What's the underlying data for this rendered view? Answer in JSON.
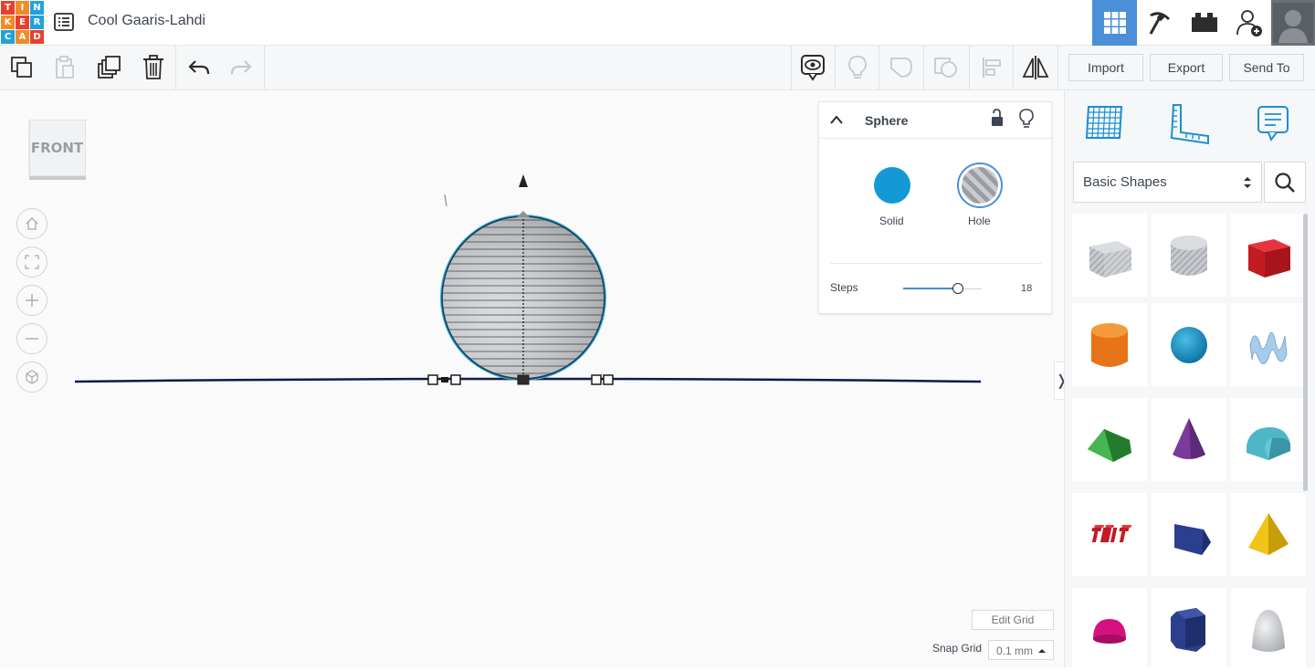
{
  "app": {
    "logo_letters": [
      "T",
      "I",
      "N",
      "K",
      "E",
      "R",
      "C",
      "A",
      "D"
    ],
    "logo_colors": [
      "#e8402e",
      "#f18a27",
      "#22a2dc",
      "#f18a27",
      "#e8402e",
      "#22a2dc",
      "#22a2dc",
      "#f18a27",
      "#e8402e"
    ],
    "title": "Cool Gaaris-Lahdi"
  },
  "topbar": {
    "buttons": [
      "3d-design-icon",
      "codeblocks-pickaxe-icon",
      "bricks-icon",
      "add-user-icon"
    ],
    "active": "3d-design-icon"
  },
  "toolbar": {
    "tools": [
      "copy-icon",
      "paste-icon",
      "duplicate-icon",
      "delete-icon",
      "undo-icon",
      "redo-icon"
    ],
    "right_tools": [
      "notes-visibility-icon",
      "light-bulb-icon",
      "group-icon",
      "ungroup-icon",
      "align-icon",
      "mirror-icon"
    ],
    "import_label": "Import",
    "export_label": "Export",
    "send_to_label": "Send To"
  },
  "viewcube": {
    "face_label": "FRONT"
  },
  "nav_controls": [
    "home-view-icon",
    "fit-view-icon",
    "zoom-in-icon",
    "zoom-out-icon",
    "ortho-view-icon"
  ],
  "inspector": {
    "title": "Sphere",
    "solid_label": "Solid",
    "hole_label": "Hole",
    "solid_color": "#1499d6",
    "selected": "Hole",
    "steps_label": "Steps",
    "steps_value": "18",
    "steps_slider_level": 0.7
  },
  "right_panel": {
    "view_icons": [
      "workplane-icon",
      "ruler-icon",
      "notes-icon"
    ],
    "category": "Basic Shapes",
    "shapes": [
      {
        "name": "box-hole",
        "color": "#b8bcc2"
      },
      {
        "name": "cylinder-hole",
        "color": "#b8bcc2"
      },
      {
        "name": "box",
        "color": "#d4202a"
      },
      {
        "name": "cylinder",
        "color": "#e8741a"
      },
      {
        "name": "sphere",
        "color": "#1499d6"
      },
      {
        "name": "scribble",
        "color": "#8ab8e0"
      },
      {
        "name": "roof",
        "color": "#2f9a3a"
      },
      {
        "name": "cone",
        "color": "#7b3a9c"
      },
      {
        "name": "round-roof",
        "color": "#4fb6c8"
      },
      {
        "name": "text",
        "color": "#d4202a"
      },
      {
        "name": "polygon",
        "color": "#2b3f8f"
      },
      {
        "name": "pyramid",
        "color": "#f0c419"
      },
      {
        "name": "half-sphere",
        "color": "#d4117f"
      },
      {
        "name": "hexagonal-prism",
        "color": "#2b3f8f"
      },
      {
        "name": "paraboloid",
        "color": "#cfd1d4"
      }
    ]
  },
  "grid": {
    "edit_label": "Edit Grid",
    "snap_label": "Snap Grid",
    "snap_value": "0.1 mm"
  }
}
